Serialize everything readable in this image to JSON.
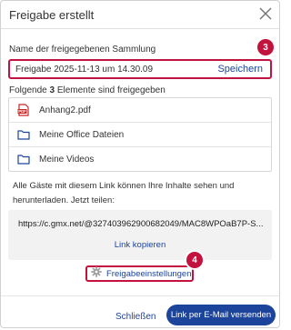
{
  "dialog": {
    "title": "Freigabe erstellt",
    "close_icon": "close-icon"
  },
  "collection": {
    "label": "Name der freigegebenen Sammlung",
    "value": "Freigabe 2025-11-13 um 14.30.09",
    "save_label": "Speichern",
    "badge": "3"
  },
  "shared": {
    "prefix": "Folgende ",
    "count": "3",
    "suffix": " Elemente sind freigegeben",
    "items": [
      {
        "label": "Anhang2.pdf",
        "icon": "pdf-icon"
      },
      {
        "label": "Meine Office Dateien",
        "icon": "folder-icon"
      },
      {
        "label": "Meine Videos",
        "icon": "folder-icon"
      }
    ]
  },
  "info_text": "Alle Gäste mit diesem Link können Ihre Inhalte sehen und herunterladen. Jetzt teilen:",
  "share": {
    "url": "https://c.gmx.net/@327403962900682049/MAC8WPOaB7P-S...",
    "copy_label": "Link kopieren"
  },
  "settings": {
    "label": "Freigabeeinstellungen",
    "icon": "gear-icon",
    "badge": "4"
  },
  "footer": {
    "cancel_label": "Schließen",
    "send_label": "Link per E-Mail versenden"
  },
  "colors": {
    "accent_blue": "#1c449b",
    "highlight_red": "#c4123e",
    "pdf_red": "#c62828"
  }
}
